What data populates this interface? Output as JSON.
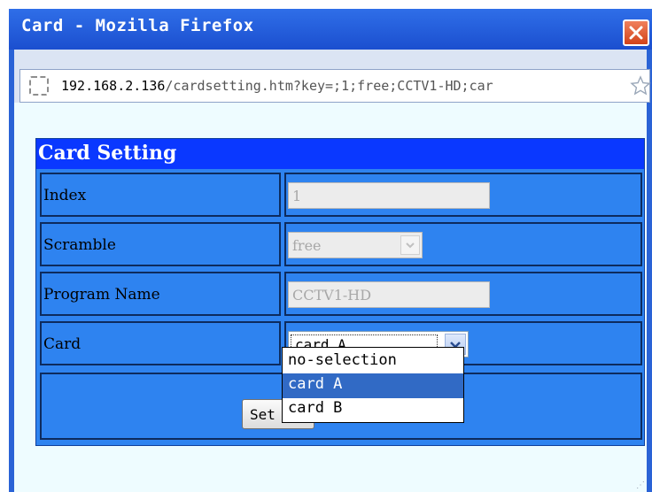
{
  "window": {
    "title": "Card - Mozilla Firefox"
  },
  "addressbar": {
    "url_host": "192.168.2.136",
    "url_path": "/cardsetting.htm?key=;1;free;CCTV1-HD;car"
  },
  "panel": {
    "title": "Card Setting",
    "rows": [
      {
        "label": "Index",
        "value": "1",
        "type": "text",
        "disabled": true
      },
      {
        "label": "Scramble",
        "value": "free",
        "type": "select",
        "disabled": true
      },
      {
        "label": "Program Name",
        "value": "CCTV1-HD",
        "type": "text",
        "disabled": true
      },
      {
        "label": "Card",
        "value": "card A",
        "type": "select",
        "disabled": false
      }
    ],
    "button_label": "Set"
  },
  "dropdown": {
    "options": [
      "no-selection",
      "card A",
      "card B"
    ],
    "selected": "card A"
  },
  "colors": {
    "panel_bg": "#2e83f0",
    "header_bg": "#0a38ff",
    "titlebar_bg": "#1b4fcf",
    "selection_bg": "#316ac5"
  },
  "icons": {
    "close": "close-icon",
    "page": "page-icon",
    "bookmark": "star-icon",
    "dropdown_arrow": "chevron-down-icon"
  }
}
